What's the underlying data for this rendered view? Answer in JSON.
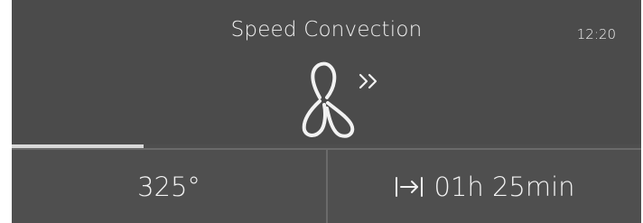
{
  "header": {
    "mode_title": "Speed Convection",
    "clock": "12:20"
  },
  "icons": {
    "mode": "fan-icon",
    "boost": "double-chevron-right-icon",
    "end_time": "arrow-to-bar-icon"
  },
  "progress": {
    "fraction": 0.21
  },
  "settings": {
    "temperature": "325°",
    "duration": "01h 25min"
  },
  "colors": {
    "background": "#4b4b4b",
    "text": "#f0f0f0",
    "progress": "#d8d8d8",
    "divider": "#6a6a6a"
  }
}
